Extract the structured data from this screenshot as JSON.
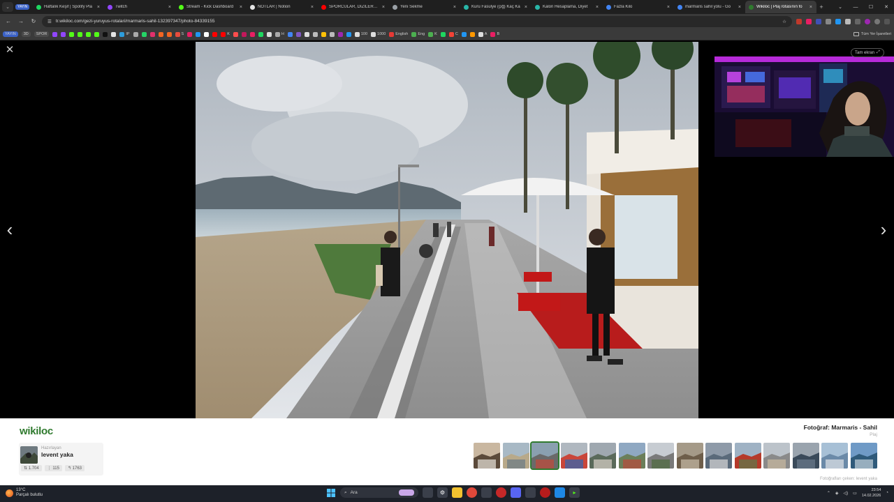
{
  "browser": {
    "tab_menu_glyph": "⌄",
    "first_tab_label": "YAYIN",
    "tabs": [
      {
        "label": "Haftalık Keşif | Spotify Pla",
        "color": "#1ed760"
      },
      {
        "label": "Twitch",
        "color": "#9146ff"
      },
      {
        "label": "Stream - Kick Dashboard",
        "color": "#53fc18"
      },
      {
        "label": "NOTLAR | Notion",
        "color": "#e5e5e5"
      },
      {
        "label": "SPORCULAR, DİZİLERDE",
        "color": "#ff0000"
      },
      {
        "label": "Yeni Sekme",
        "color": "#9aa0a6"
      },
      {
        "label": "Kuru Fasulye (çiğ) Kaç Ka",
        "color": "#29b6a8"
      },
      {
        "label": "Kalori Hesaplama, Diyet",
        "color": "#29b6a8"
      },
      {
        "label": "Fazla Kilo",
        "color": "#4285f4"
      },
      {
        "label": "marmaris sahil yolu - Go",
        "color": "#4285f4"
      },
      {
        "label": "Wikiloc | Plaj rotasının fo",
        "color": "#2f7a2e",
        "active": true
      }
    ],
    "tab_close_glyph": "×",
    "new_tab_glyph": "+",
    "window_controls": {
      "dropdown": "⌄",
      "minimize": "—",
      "maximize": "☐",
      "close": "✕"
    },
    "address": {
      "url": "tr.wikiloc.com/gezi-yuruyus-rotalari/marmaris-sahil-132397347/photo-84339155",
      "back": "←",
      "forward": "→",
      "reload": "↻",
      "site_info": "☰",
      "star": "☆"
    },
    "bookmarks": [
      {
        "label": "YAYIN",
        "color": "#3b62c7",
        "box": true
      },
      {
        "label": "3D",
        "color": "",
        "box": true
      },
      {
        "label": "SPOR",
        "color": "",
        "box": true
      },
      {
        "label": "",
        "color": "#9146ff"
      },
      {
        "label": "",
        "color": "#9146ff"
      },
      {
        "label": "",
        "color": "#53fc18"
      },
      {
        "label": "",
        "color": "#53fc18"
      },
      {
        "label": "",
        "color": "#53fc18"
      },
      {
        "label": "",
        "color": "#53fc18"
      },
      {
        "label": "",
        "color": "#111111"
      },
      {
        "label": "",
        "color": "#e5e5e5"
      },
      {
        "label": "IP",
        "color": "#2d9cdb"
      },
      {
        "label": "",
        "color": "#aaaaaa"
      },
      {
        "label": "",
        "color": "#25d366"
      },
      {
        "label": "",
        "color": "#e1306c"
      },
      {
        "label": "",
        "color": "#f26522"
      },
      {
        "label": "",
        "color": "#f26522"
      },
      {
        "label": "S",
        "color": "#e74c3c"
      },
      {
        "label": "",
        "color": "#e91e63"
      },
      {
        "label": "",
        "color": "#2196f3"
      },
      {
        "label": "",
        "color": "#ffffff"
      },
      {
        "label": "",
        "color": "#ff0000"
      },
      {
        "label": "K",
        "color": "#ff0000"
      },
      {
        "label": "",
        "color": "#ff4d4d"
      },
      {
        "label": "",
        "color": "#c2185b"
      },
      {
        "label": "",
        "color": "#e91e63"
      },
      {
        "label": "",
        "color": "#1ed760"
      },
      {
        "label": "",
        "color": "#dddddd"
      },
      {
        "label": "H",
        "color": "#aaaaaa"
      },
      {
        "label": "",
        "color": "#4285f4"
      },
      {
        "label": "",
        "color": "#7e57c2"
      },
      {
        "label": "",
        "color": "#dddddd"
      },
      {
        "label": "",
        "color": "#bbbbbb"
      },
      {
        "label": "",
        "color": "#ffc107"
      },
      {
        "label": "",
        "color": "#bbbbbb"
      },
      {
        "label": "",
        "color": "#9c27b0"
      },
      {
        "label": "",
        "color": "#2196f3"
      },
      {
        "label": "100",
        "color": "#dddddd"
      },
      {
        "label": "1000",
        "color": "#dddddd"
      },
      {
        "label": "English",
        "color": "#e53935"
      },
      {
        "label": "Eng",
        "color": "#4caf50"
      },
      {
        "label": "K",
        "color": "#4caf50"
      },
      {
        "label": "",
        "color": "#1ed760"
      },
      {
        "label": "C",
        "color": "#f44336"
      },
      {
        "label": "",
        "color": "#2196f3"
      },
      {
        "label": "",
        "color": "#ff9800"
      },
      {
        "label": "A",
        "color": "#dddddd"
      },
      {
        "label": "B",
        "color": "#e91e63"
      }
    ],
    "bookmarks_all": "Tüm Yer İşaretleri"
  },
  "viewer": {
    "close_glyph": "✕",
    "prev_glyph": "‹",
    "next_glyph": "›",
    "fullscreen_label": "Tam ekran",
    "fullscreen_glyph": "⤢"
  },
  "info": {
    "logo": "wikiloc",
    "prepared_by_label": "Hazırlayan",
    "author_name": "levent yaka",
    "stats": [
      "1.704",
      "115",
      "1763"
    ],
    "photo_title": "Fotoğraf: Marmaris - Sahil",
    "photo_subtitle": "Plaj",
    "thumbnail_count": 14,
    "active_thumbnail_index": 2,
    "credit": "Fotoğrafları çeken: levent yaka"
  },
  "taskbar": {
    "weather_temp": "13°C",
    "weather_desc": "Parçalı bulutlu",
    "search_label": "Ara",
    "time": "23:54",
    "date": "14.02.2026"
  },
  "colors": {
    "wikiloc_green": "#2f7a2e",
    "browser_dark": "#1f1f1f",
    "taskbar": "#1d2129"
  }
}
